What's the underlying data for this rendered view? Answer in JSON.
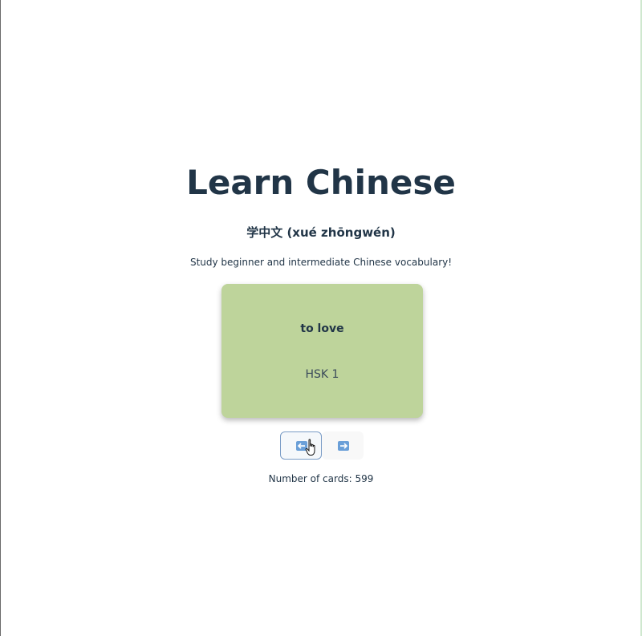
{
  "header": {
    "title": "Learn Chinese",
    "subtitle": "学中文 (xué zhōngwén)",
    "description": "Study beginner and intermediate Chinese vocabulary!"
  },
  "card": {
    "word": "to love",
    "level": "HSK 1",
    "background_color": "#bed49b"
  },
  "navigation": {
    "prev_icon": "arrow-left-icon",
    "next_icon": "arrow-right-icon",
    "icon_color": "#6a9fd8"
  },
  "footer": {
    "count_label": "Number of cards: 599"
  },
  "colors": {
    "text": "#213547",
    "focus_border": "#7a9cc6"
  }
}
